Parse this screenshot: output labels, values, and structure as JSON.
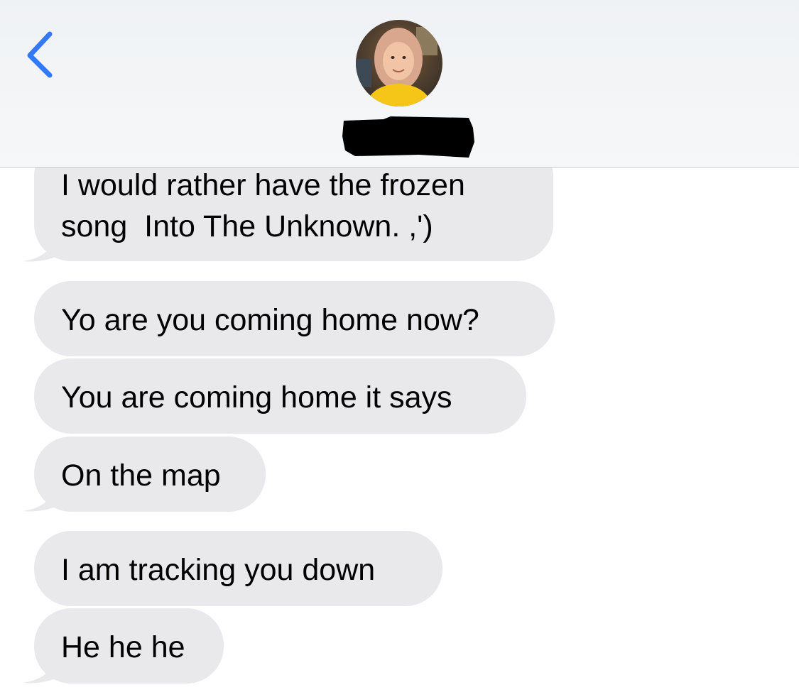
{
  "header": {
    "back_icon": "chevron-left-icon",
    "avatar_description": "contact-photo",
    "contact_name": "",
    "accent_color": "#3478f6"
  },
  "messages": [
    {
      "text": "I would rather have the frozen\nsong  Into The Unknown. ,')",
      "tail": true
    },
    {
      "text": "Yo are you coming home now?",
      "tail": false
    },
    {
      "text": "You are coming home it says",
      "tail": false
    },
    {
      "text": "On the map",
      "tail": true
    },
    {
      "text": "I am tracking you down",
      "tail": false
    },
    {
      "text": "He he he",
      "tail": true
    }
  ],
  "colors": {
    "bubble_received": "#e9e9eb",
    "header_bg": "#eff2f5",
    "text": "#000000"
  }
}
